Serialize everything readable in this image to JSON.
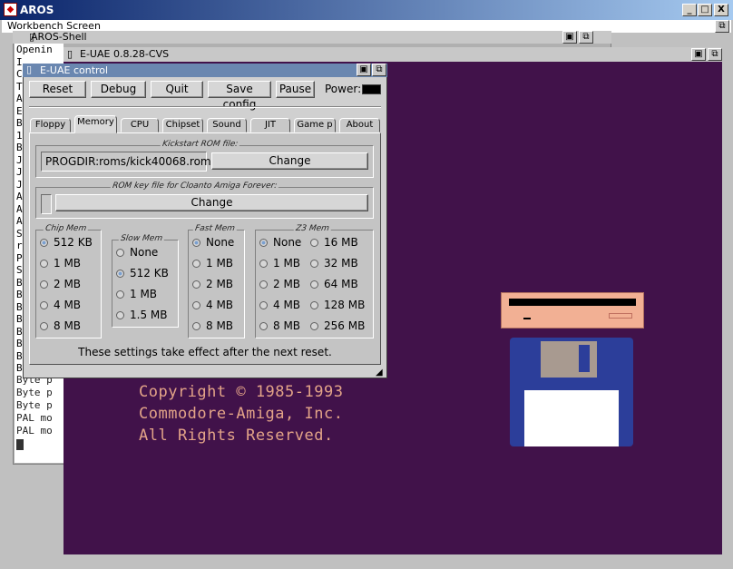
{
  "host": {
    "title": "AROS",
    "minimize": "_",
    "maximize": "□",
    "close": "X"
  },
  "workbench": {
    "title": "Workbench Screen"
  },
  "shell": {
    "title": "AROS-Shell",
    "lines_top": [
      "Openin",
      "I",
      "C",
      "T",
      "A",
      "E",
      "B",
      "1",
      "B",
      "J",
      "J",
      "J",
      "A",
      "A",
      "A",
      "S",
      "r",
      "P",
      "S",
      "B",
      "B",
      "B",
      "B",
      "B",
      "B",
      "B",
      "B"
    ],
    "lines_bottom": [
      "Byte p",
      "Byte p",
      "Byte p",
      "PAL mo",
      "PAL mo"
    ]
  },
  "emulator": {
    "title": "E-UAE 0.8.28-CVS",
    "copyright": [
      "Copyright © 1985-1993",
      "Commodore-Amiga, Inc.",
      "All Rights Reserved."
    ]
  },
  "control": {
    "title": "E-UAE control",
    "buttons": {
      "reset": "Reset",
      "debug": "Debug",
      "quit": "Quit",
      "save": "Save config",
      "pause": "Pause"
    },
    "power_label": "Power:",
    "tabs": [
      "Floppy",
      "Memory",
      "CPU",
      "Chipset",
      "Sound",
      "JIT",
      "Game p",
      "About"
    ],
    "active_tab": "Memory",
    "kickstart": {
      "label": "Kickstart ROM file:",
      "path": "PROGDIR:roms/kick40068.rom",
      "change": "Change"
    },
    "romkey": {
      "label": "ROM key file for Cloanto Amiga Forever:",
      "change": "Change"
    },
    "chip": {
      "label": "Chip Mem",
      "options": [
        "512 KB",
        "1 MB",
        "2 MB",
        "4 MB",
        "8 MB"
      ],
      "selected": "512 KB"
    },
    "slow": {
      "label": "Slow Mem",
      "options": [
        "None",
        "512 KB",
        "1 MB",
        "1.5 MB"
      ],
      "selected": "512 KB"
    },
    "fast": {
      "label": "Fast Mem",
      "options": [
        "None",
        "1 MB",
        "2 MB",
        "4 MB",
        "8 MB"
      ],
      "selected": "None"
    },
    "z3": {
      "label": "Z3 Mem",
      "col1": [
        "None",
        "1 MB",
        "2 MB",
        "4 MB",
        "8 MB"
      ],
      "col2": [
        "16 MB",
        "32 MB",
        "64 MB",
        "128 MB",
        "256 MB"
      ],
      "selected": "None"
    },
    "footer": "These settings take effect after the next reset."
  },
  "colors": {
    "screen_bg": "#41124a",
    "copyright_text": "#e3a488",
    "title_active": "#6a87b0"
  }
}
